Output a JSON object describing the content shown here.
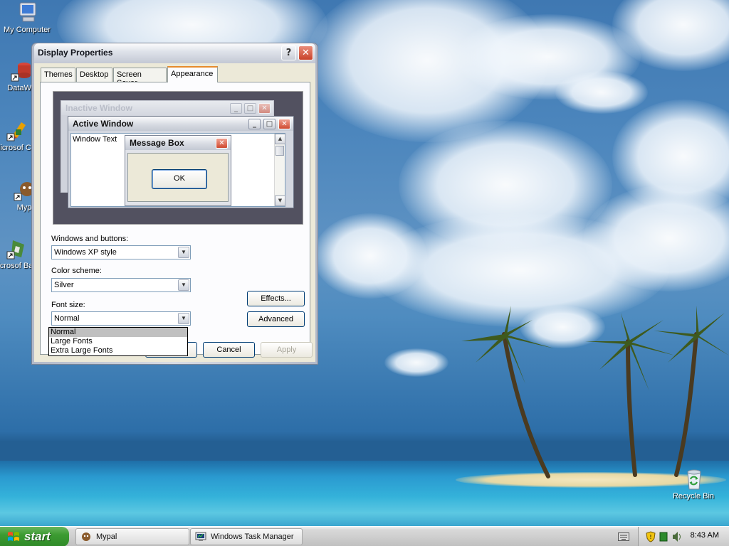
{
  "desktop": {
    "icons": [
      {
        "label": "My Computer"
      },
      {
        "label": "DataWa"
      },
      {
        "label": "Microsof C++"
      },
      {
        "label": "Myp"
      },
      {
        "label": "Microsof Basic"
      },
      {
        "label": "Recycle Bin"
      }
    ]
  },
  "dialog": {
    "title": "Display Properties",
    "help_label": "?",
    "close_label": "✕",
    "tabs": [
      {
        "label": "Themes"
      },
      {
        "label": "Desktop"
      },
      {
        "label": "Screen Saver"
      },
      {
        "label": "Appearance",
        "active": true
      }
    ],
    "preview": {
      "inactive_title": "Inactive Window",
      "active_title": "Active Window",
      "window_text": "Window Text",
      "msgbox_title": "Message Box",
      "msgbox_ok": "OK"
    },
    "windows_buttons": {
      "label": "Windows and buttons:",
      "value": "Windows XP style"
    },
    "color_scheme": {
      "label": "Color scheme:",
      "value": "Silver"
    },
    "font_size": {
      "label": "Font size:",
      "value": "Normal",
      "options": [
        "Normal",
        "Large Fonts",
        "Extra Large Fonts"
      ],
      "selected_index": 0
    },
    "effects_label": "Effects...",
    "advanced_label": "Advanced",
    "cancel_label": "Cancel",
    "apply_label": "Apply"
  },
  "taskbar": {
    "start_label": "start",
    "tasks": [
      {
        "label": "Mypal"
      },
      {
        "label": "Windows Task Manager"
      }
    ],
    "clock": "8:43 AM"
  }
}
